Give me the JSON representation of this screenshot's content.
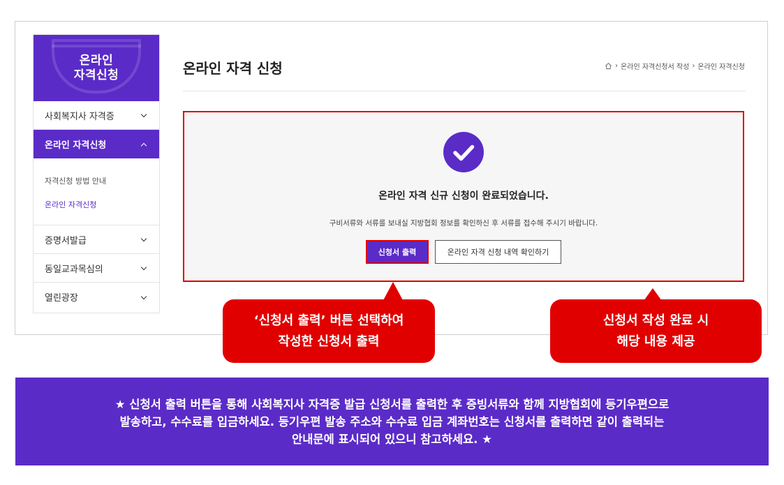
{
  "sidebar": {
    "title_line1": "온라인",
    "title_line2": "자격신청",
    "items": [
      {
        "label": "사회복지사 자격증"
      },
      {
        "label": "온라인 자격신청"
      },
      {
        "label": "증명서발급"
      },
      {
        "label": "동일교과목심의"
      },
      {
        "label": "열린광장"
      }
    ],
    "submenu": [
      {
        "label": "자격신청 방법 안내"
      },
      {
        "label": "온라인 자격신청"
      }
    ]
  },
  "main": {
    "title": "온라인 자격 신청",
    "breadcrumb": [
      "온라인 자격신청서 작성",
      "온라인 자격신청"
    ],
    "breadcrumb_sep": "›",
    "result_message": "온라인 자격 신규 신청이 완료되었습니다.",
    "result_sub": "구비서류와 서류를 보내실 지방협회 정보를 확인하신 후 서류를 접수해 주시기 바랍니다.",
    "print_button": "신청서 출력",
    "history_button": "온라인 자격 신청 내역 확인하기"
  },
  "callouts": {
    "left_line1": "‘신청서 출력’ 버튼 선택하여",
    "left_line2": "작성한 신청서 출력",
    "right_line1": "신청서 작성 완료 시",
    "right_line2": "해당 내용 제공"
  },
  "banner": {
    "line1": "★ 신청서 출력 버튼을 통해 사회복지사 자격증 발급 신청서를 출력한 후 증빙서류와 함께 지방협회에 등기우편으로",
    "line2": "발송하고, 수수료를 입금하세요. 등기우편 발송 주소와 수수료 입금 계좌번호는 신청서를 출력하면 같이 출력되는",
    "line3": "안내문에 표시되어 있으니 참고하세요. ★"
  },
  "colors": {
    "brand": "#5b2bc8",
    "highlight": "#e10000",
    "panel": "#f6f6f6"
  }
}
